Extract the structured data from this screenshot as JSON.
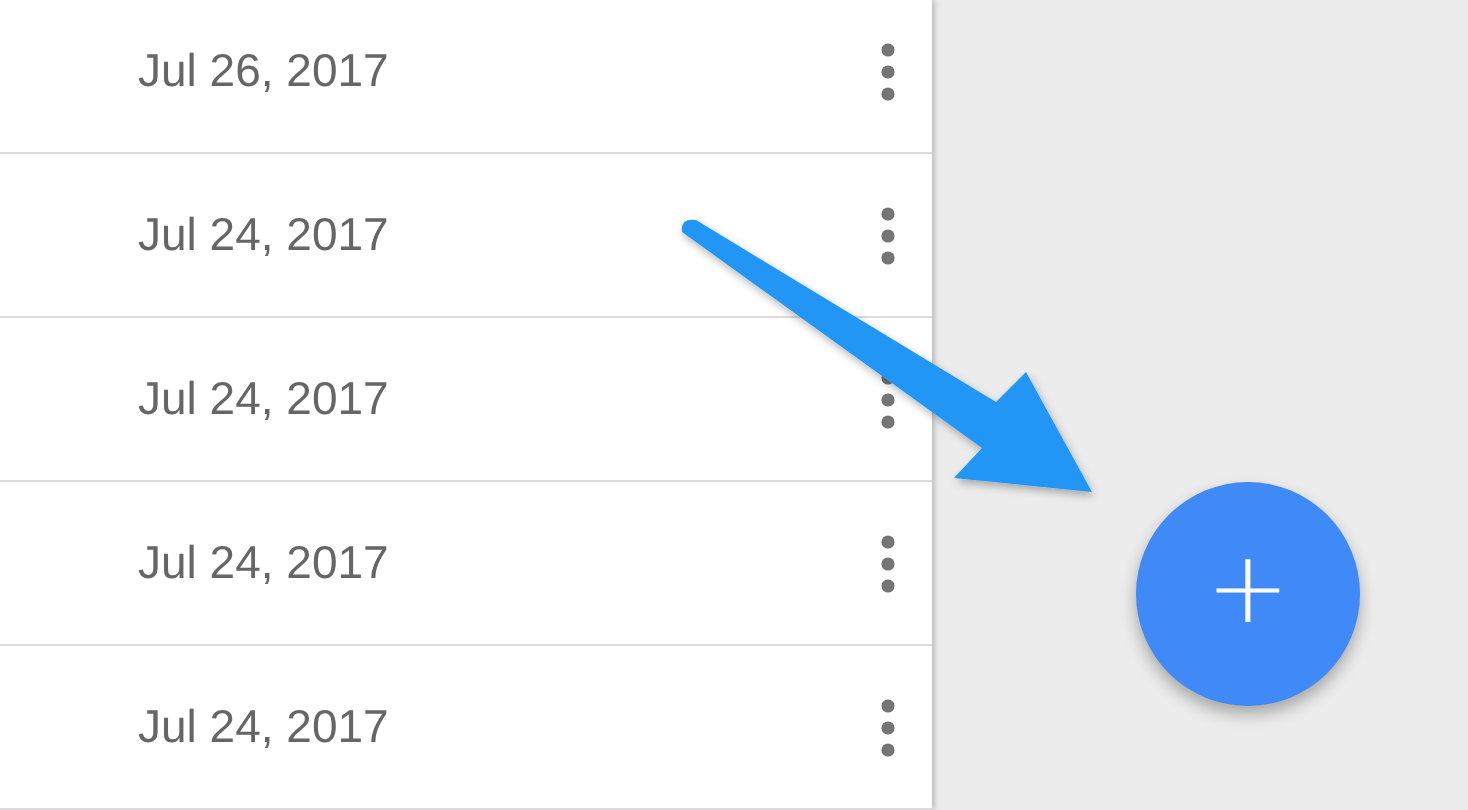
{
  "rows": [
    {
      "date": "Jul 26, 2017"
    },
    {
      "date": "Jul 24, 2017"
    },
    {
      "date": "Jul 24, 2017"
    },
    {
      "date": "Jul 24, 2017"
    },
    {
      "date": "Jul 24, 2017"
    }
  ],
  "fab": {
    "label": "+"
  }
}
